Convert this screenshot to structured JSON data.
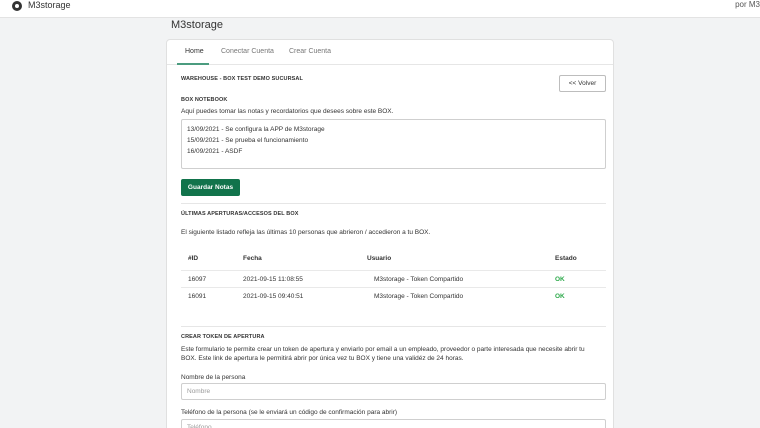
{
  "app": {
    "brand": "M3storage",
    "byline": "por M3"
  },
  "page": {
    "title": "M3storage"
  },
  "tabs": [
    {
      "label": "Home",
      "active": true
    },
    {
      "label": "Conectar Cuenta",
      "active": false
    },
    {
      "label": "Crear Cuenta",
      "active": false
    }
  ],
  "warehouse": {
    "heading": "WAREHOUSE - BOX TEST DEMO SUCURSAL",
    "back_label": "<< Volver"
  },
  "notebook": {
    "heading": "BOX NOTEBOOK",
    "description": "Aquí puedes tomar las notas y recordatorios que desees sobre este BOX.",
    "lines": [
      "13/09/2021 - Se configura la APP de M3storage",
      "15/09/2021 - Se prueba el funcionamiento",
      "16/09/2021 - ASDF"
    ],
    "save_label": "Guardar Notas"
  },
  "accesses": {
    "heading": "ÚLTIMAS APERTURAS/ACCESOS DEL BOX",
    "description": "El siguiente listado refleja las últimas 10 personas que abrieron / accedieron a tu BOX.",
    "columns": [
      "#ID",
      "Fecha",
      "Usuario",
      "Estado"
    ],
    "rows": [
      {
        "id": "16097",
        "fecha": "2021-09-15 11:08:55",
        "usuario": "M3storage - Token Compartido",
        "estado": "OK"
      },
      {
        "id": "16091",
        "fecha": "2021-09-15 09:40:51",
        "usuario": "M3storage - Token Compartido",
        "estado": "OK"
      }
    ]
  },
  "token": {
    "heading": "CREAR TOKEN DE APERTURA",
    "description_1": "Este formulario te permite crear un token de apertura y enviarlo por email a un empleado, proveedor o parte interesada que necesite abrir tu",
    "description_2": "BOX. Este link de apertura le permitirá abrir por única vez tu BOX y tiene una validéz de 24 horas.",
    "name_label": "Nombre de la persona",
    "name_placeholder": "Nombre",
    "phone_label": "Teléfono de la persona (se le enviará un código de confirmación para abrir)",
    "phone_placeholder": "Teléfono"
  },
  "colors": {
    "accent": "#11734b",
    "ok": "#2ca94a"
  }
}
